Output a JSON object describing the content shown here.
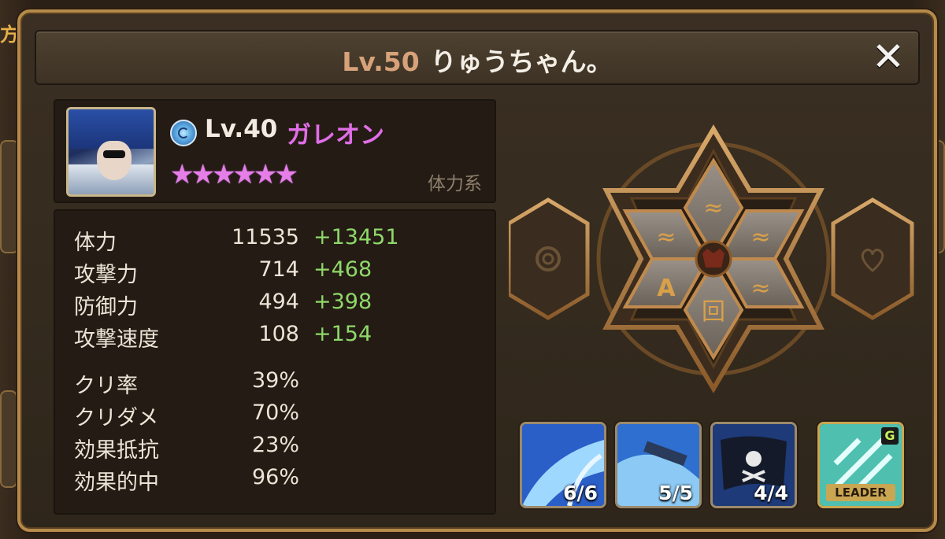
{
  "background": {
    "tab_text": "方"
  },
  "header": {
    "level": "Lv.50",
    "player_name": "りゅうちゃん。",
    "close_symbol": "✕"
  },
  "monster": {
    "element_icon": "wind-element-icon",
    "level": "Lv.40",
    "name": "ガレオン",
    "stars": "★★★★★★",
    "star_count": 6,
    "type": "体力系"
  },
  "stats": [
    {
      "label": "体力",
      "base": "11535",
      "bonus": "+13451"
    },
    {
      "label": "攻撃力",
      "base": "714",
      "bonus": "+468"
    },
    {
      "label": "防御力",
      "base": "494",
      "bonus": "+398"
    },
    {
      "label": "攻撃速度",
      "base": "108",
      "bonus": "+154"
    },
    {
      "label": "クリ率",
      "base": "39%",
      "bonus": ""
    },
    {
      "label": "クリダメ",
      "base": "70%",
      "bonus": ""
    },
    {
      "label": "効果抵抗",
      "base": "23%",
      "bonus": ""
    },
    {
      "label": "効果的中",
      "base": "96%",
      "bonus": ""
    }
  ],
  "runes": {
    "slots": [
      "rune-slot-1",
      "rune-slot-2",
      "rune-slot-3",
      "rune-slot-4",
      "rune-slot-5",
      "rune-slot-6"
    ],
    "left_artifact": "spiral-artifact-icon",
    "right_artifact": "heart-artifact-icon"
  },
  "skills": [
    {
      "name": "skill-1",
      "level": "6/6"
    },
    {
      "name": "skill-2",
      "level": "5/5"
    },
    {
      "name": "skill-3",
      "level": "4/4"
    },
    {
      "name": "leader-skill",
      "label": "LEADER",
      "badge": "G"
    }
  ],
  "colors": {
    "accent_gold": "#b58a4a",
    "name_pink": "#e06ee8",
    "bonus_green": "#8fd86a",
    "level_orange": "#d7a27a"
  }
}
